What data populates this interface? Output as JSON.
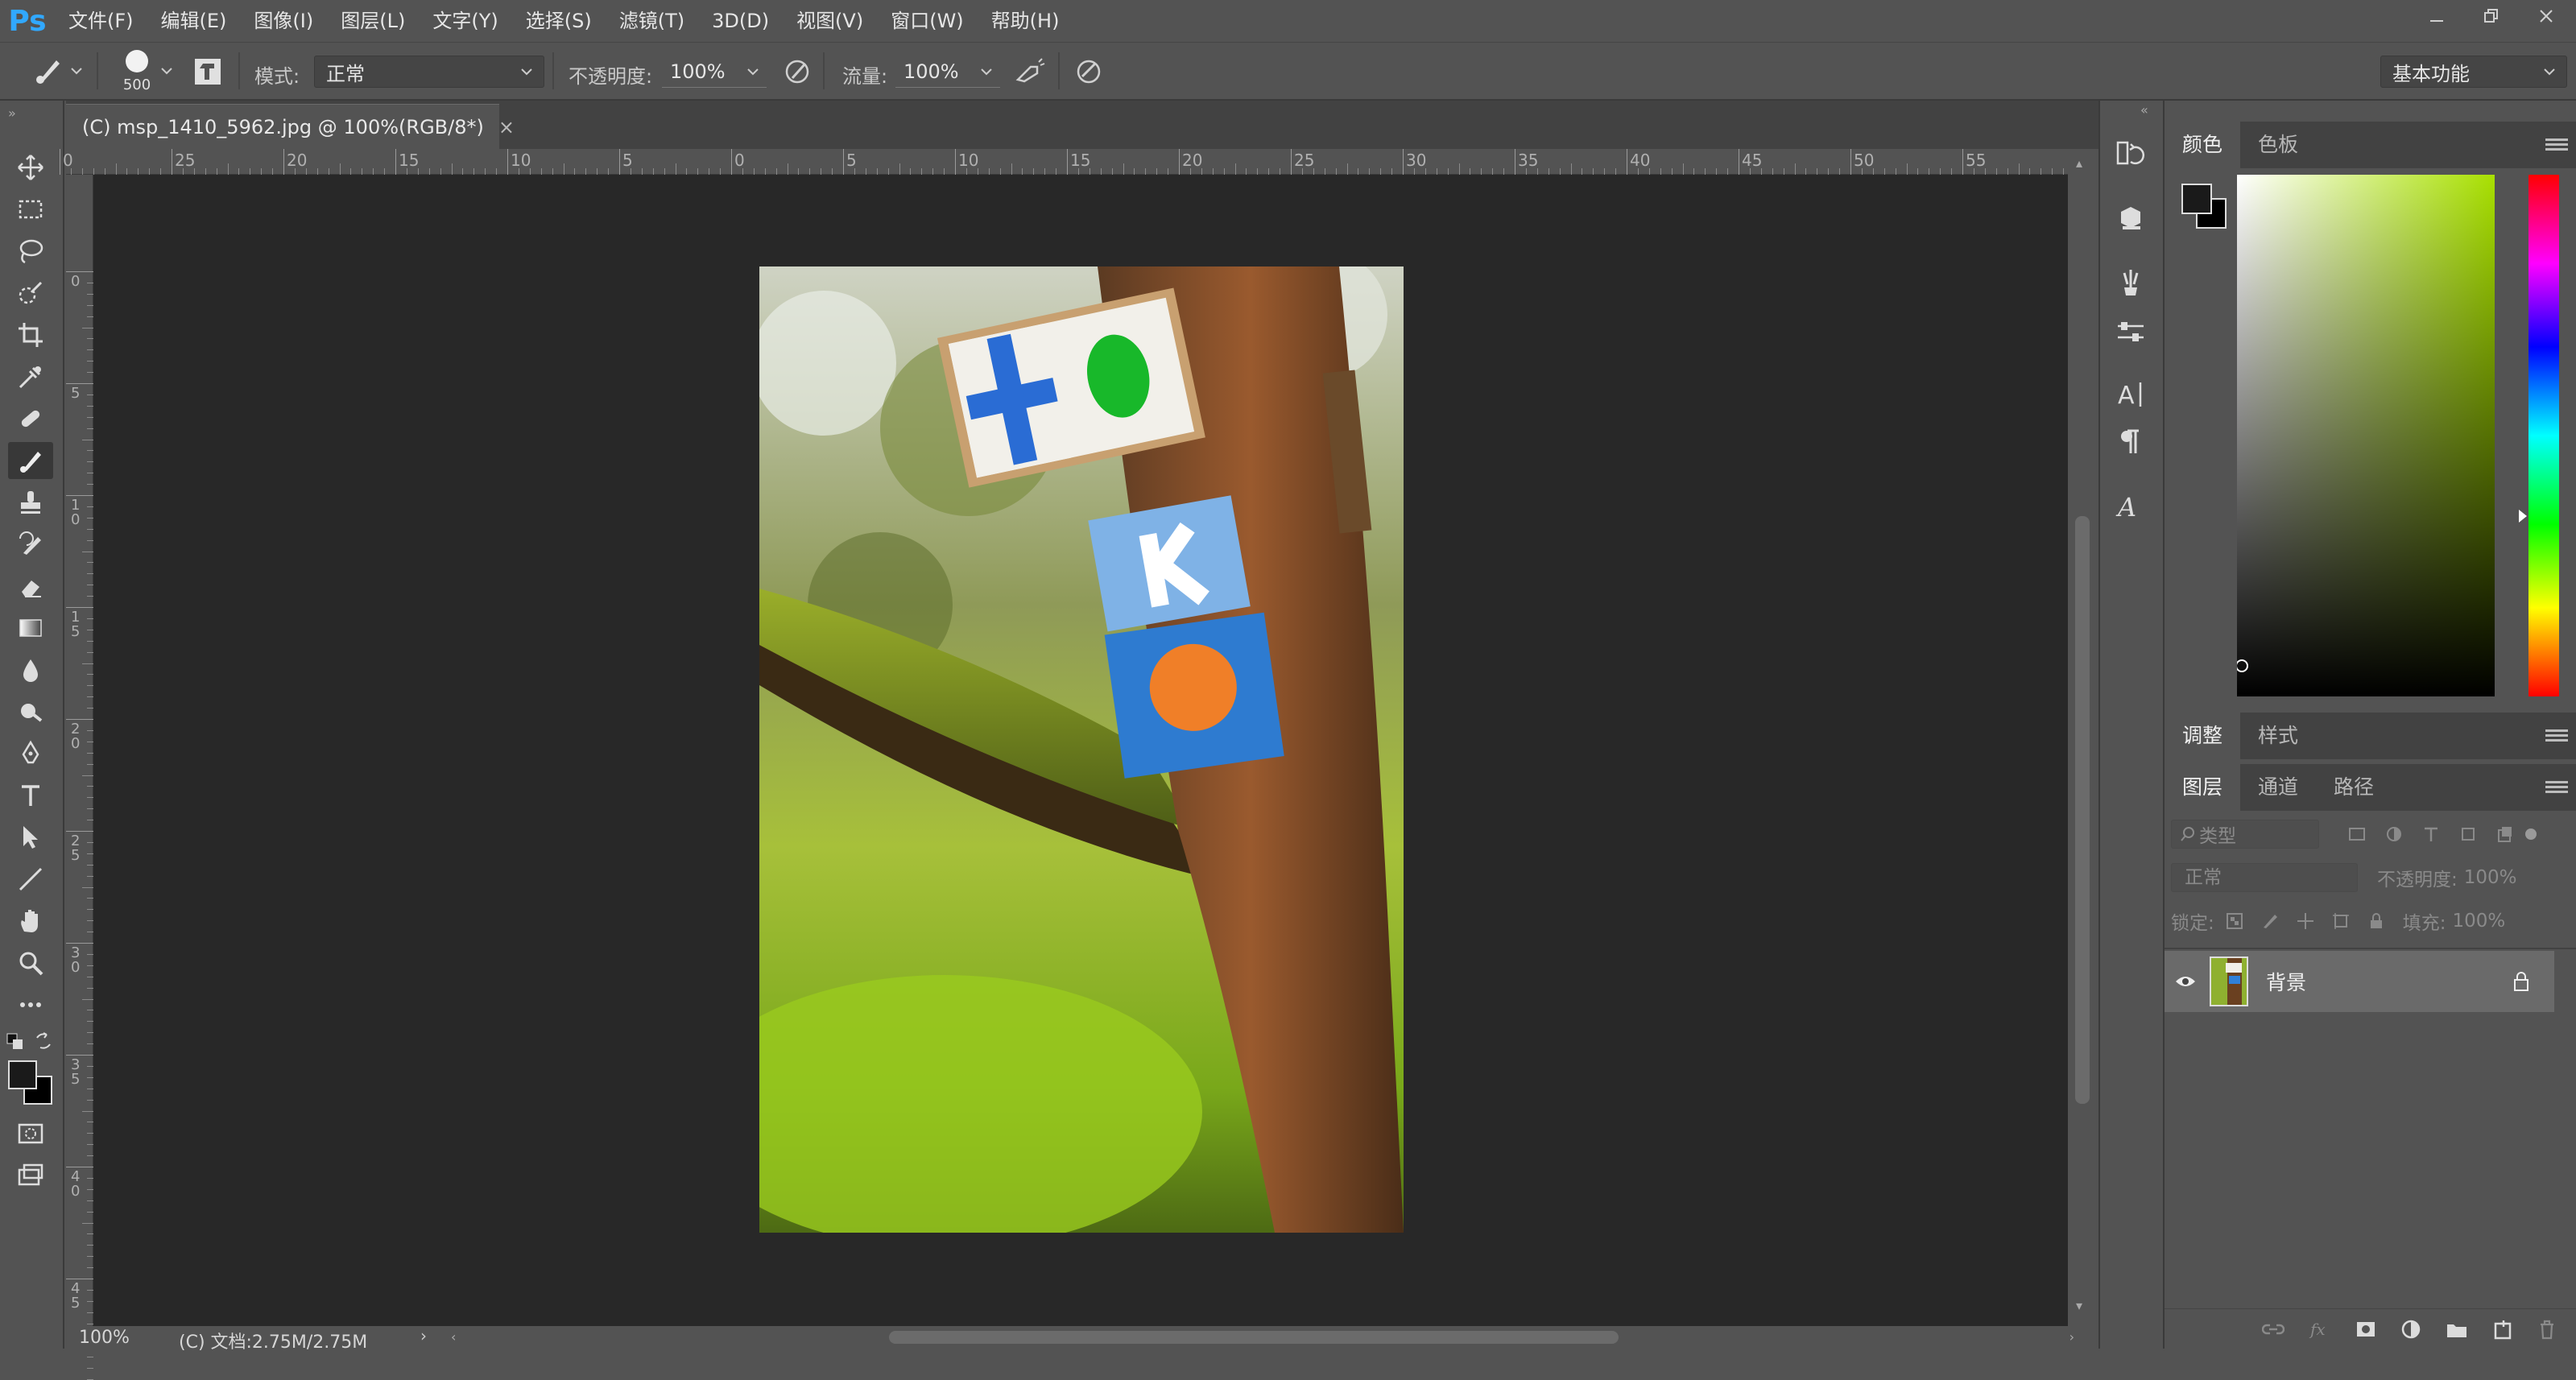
{
  "app": {
    "logo": "Ps"
  },
  "menu": [
    "文件(F)",
    "编辑(E)",
    "图像(I)",
    "图层(L)",
    "文字(Y)",
    "选择(S)",
    "滤镜(T)",
    "3D(D)",
    "视图(V)",
    "窗口(W)",
    "帮助(H)"
  ],
  "options": {
    "brush_size": "500",
    "mode_label": "模式:",
    "mode_value": "正常",
    "opacity_label": "不透明度:",
    "opacity_value": "100%",
    "flow_label": "流量:",
    "flow_value": "100%",
    "workspace": "基本功能"
  },
  "document": {
    "tab_title": "(C) msp_1410_5962.jpg @ 100%(RGB/8*)",
    "zoom": "100%",
    "doc_info": "(C) 文档:2.75M/2.75M"
  },
  "rulers": {
    "horizontal": [
      "0",
      "25",
      "20",
      "15",
      "10",
      "5",
      "0",
      "5",
      "10",
      "15",
      "20",
      "25",
      "30",
      "35",
      "40",
      "45",
      "50",
      "55"
    ],
    "vertical": [
      "0",
      "5",
      "1\n0",
      "1\n5",
      "2\n0",
      "2\n5",
      "3\n0",
      "3\n5",
      "4\n0",
      "4\n5"
    ]
  },
  "color_panel": {
    "tabs": [
      "颜色",
      "色板"
    ],
    "active_tab": "颜色",
    "foreground": "#1a1a1a",
    "background": "#000000",
    "hue_color": "#a8e000"
  },
  "adjust_panel": {
    "tabs": [
      "调整",
      "样式"
    ]
  },
  "layers_panel": {
    "tabs": [
      "图层",
      "通道",
      "路径"
    ],
    "filter_placeholder": "类型",
    "blend_mode": "正常",
    "opacity_label": "不透明度:",
    "opacity_value": "100%",
    "lock_label": "锁定:",
    "fill_label": "填充:",
    "fill_value": "100%",
    "layers": [
      {
        "name": "背景",
        "visible": true,
        "locked": true
      }
    ]
  }
}
